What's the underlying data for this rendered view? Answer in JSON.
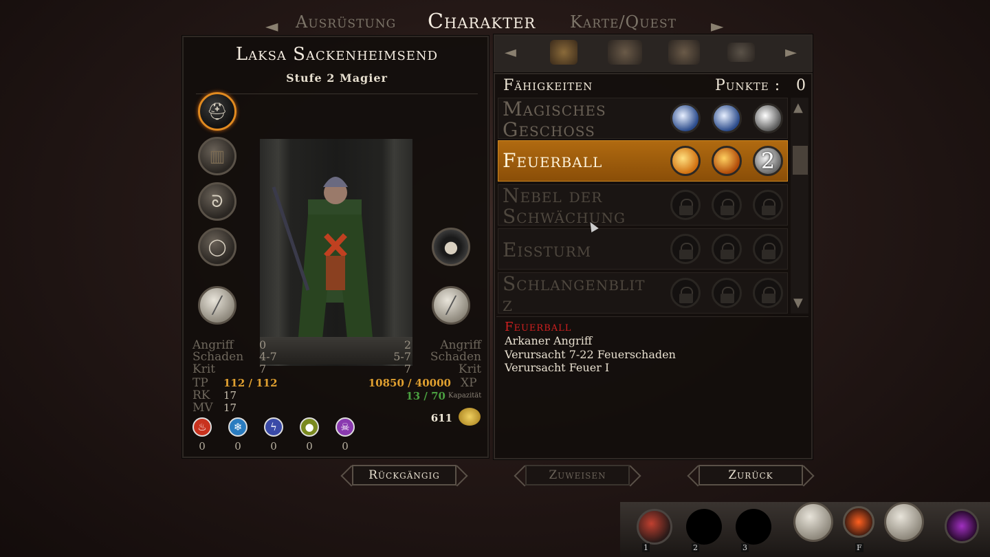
{
  "nav": {
    "left_tab": "Ausrüstung",
    "active_tab": "Charakter",
    "right_tab": "Karte/Quest",
    "left_arrow": "◄",
    "right_arrow": "►"
  },
  "character": {
    "name": "Laksa Sackenheimsend",
    "subtitle": "Stufe  2  Magier"
  },
  "stats_left": [
    {
      "label": "Angriff",
      "value": "0"
    },
    {
      "label": "Schaden",
      "value": "4-7"
    },
    {
      "label": "Krit",
      "value": "7"
    }
  ],
  "stats_right": [
    {
      "label": "Angriff",
      "value": "2"
    },
    {
      "label": "Schaden",
      "value": "5-7"
    },
    {
      "label": "Krit",
      "value": "7"
    }
  ],
  "vitals": {
    "tp_label": "TP",
    "tp_value": "112 / 112",
    "rk_label": "RK",
    "rk_value": "17",
    "mv_label": "MV",
    "mv_value": "17",
    "xp_value": "10850 / 40000",
    "xp_label": "XP",
    "capacity_value": "13 / 70",
    "capacity_label": "Kapazität",
    "gold": "611"
  },
  "resistances": [
    {
      "icon": "fire-icon",
      "value": "0",
      "color": "#c8321e"
    },
    {
      "icon": "frost-icon",
      "value": "0",
      "color": "#2a7cc0"
    },
    {
      "icon": "lightning-icon",
      "value": "0",
      "color": "#3a4aa8"
    },
    {
      "icon": "poison-icon",
      "value": "0",
      "color": "#7a8a20"
    },
    {
      "icon": "death-icon",
      "value": "0",
      "color": "#8a3ab0"
    }
  ],
  "skills_header": {
    "title": "Fähigkeiten",
    "points_label": "Punkte :",
    "points": "0"
  },
  "skills": [
    {
      "name": "Magisches\nGeschoss",
      "state": "unlocked"
    },
    {
      "name": "Feuerball",
      "state": "selected",
      "rank_badge": "2"
    },
    {
      "name": "Nebel der\nSchwächung",
      "state": "locked"
    },
    {
      "name": "Eissturm",
      "state": "locked"
    },
    {
      "name": "Schlangenblit\nz",
      "state": "locked"
    }
  ],
  "description": {
    "title": "Feuerball",
    "lines": [
      "Arkaner Angriff",
      "Verursacht 7-22 Feuerschaden",
      "Verursacht Feuer I"
    ]
  },
  "buttons": {
    "undo": "Rückgängig",
    "assign": "Zuweisen",
    "back": "Zurück"
  },
  "hotbar": {
    "slot_numbers": [
      "1",
      "2",
      "3",
      "F"
    ]
  },
  "colors": {
    "accent": "#e08a20",
    "tp": "#e0a030",
    "capacity": "#4aa040",
    "desc_title": "#d02020"
  }
}
